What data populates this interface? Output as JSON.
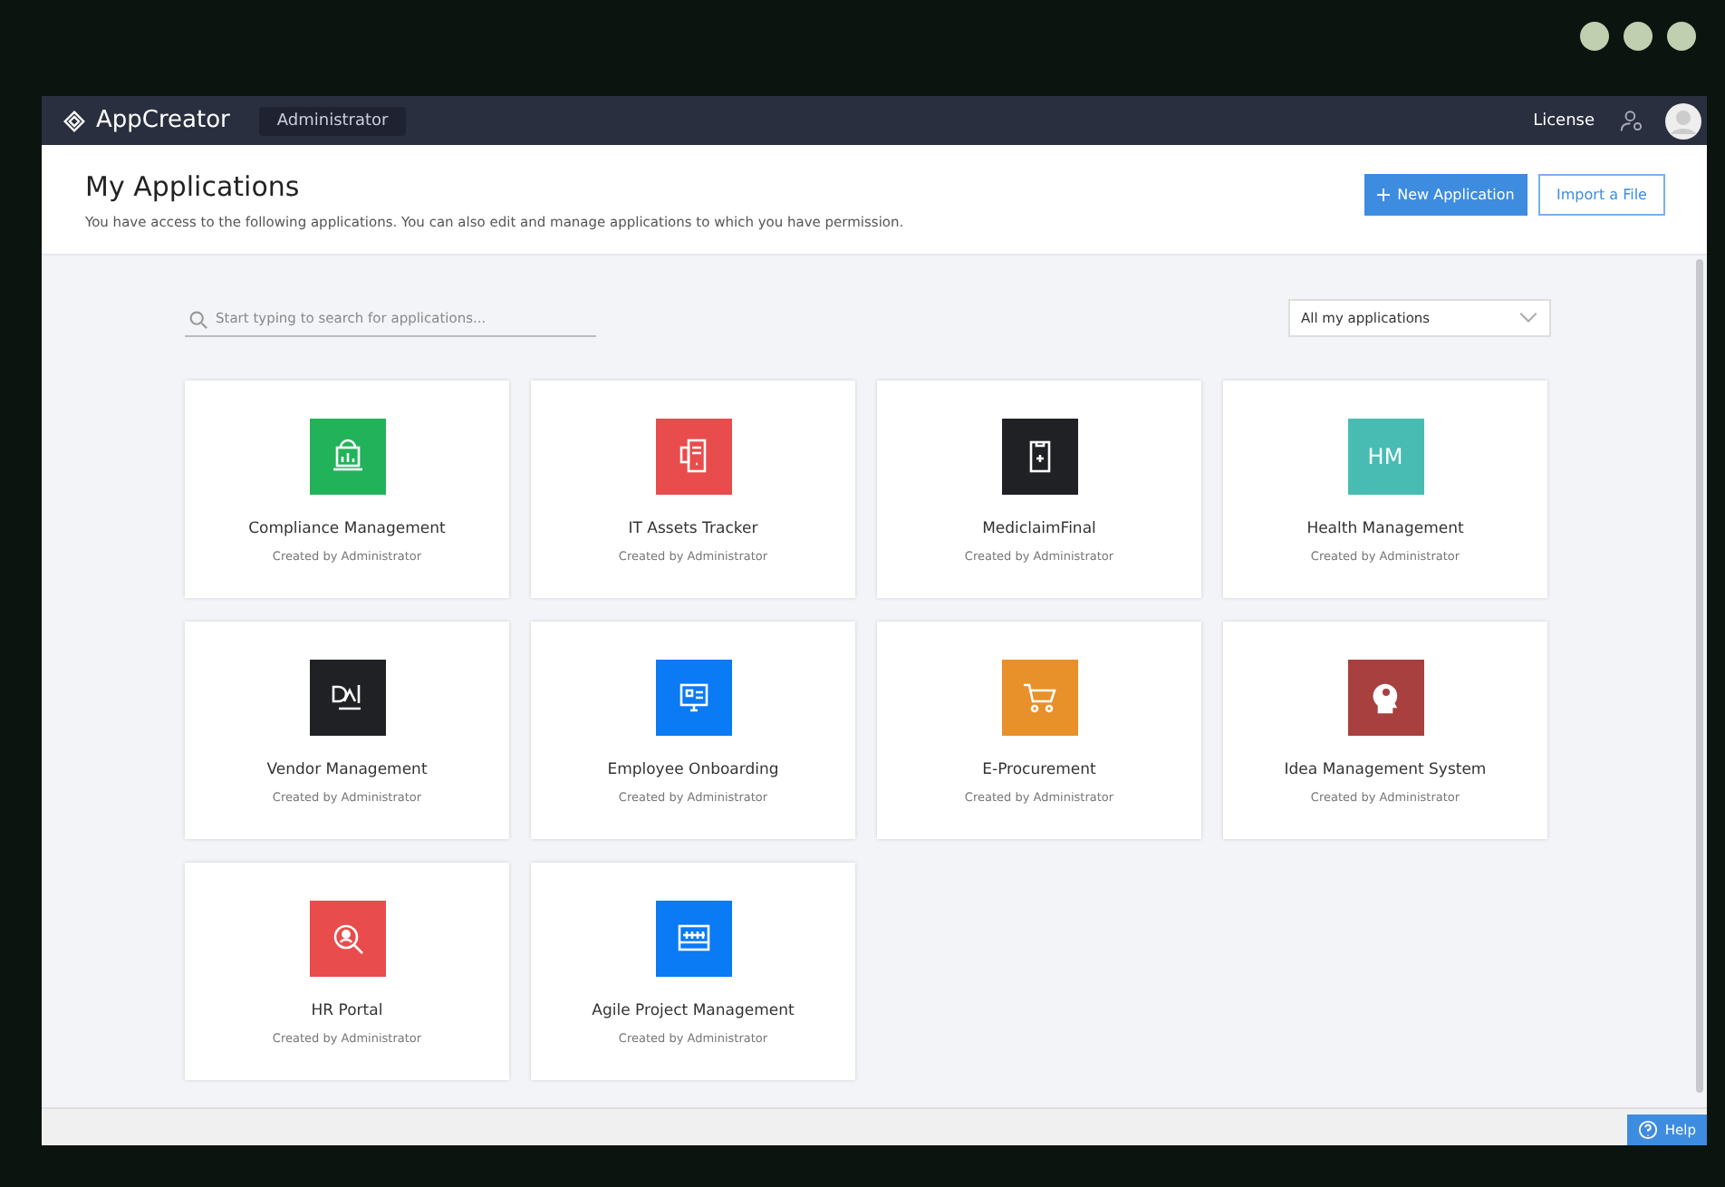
{
  "header": {
    "brand": "AppCreator",
    "role": "Administrator",
    "license_link": "License"
  },
  "page": {
    "title": "My Applications",
    "subtitle": "You have access to the following applications. You can also edit and manage applications to which you have permission.",
    "buttons": [
      {
        "kind": "primary",
        "label": "New Application"
      },
      {
        "kind": "secondary",
        "label": "Import a File"
      }
    ]
  },
  "search": {
    "placeholder": "Start typing to search for applications..."
  },
  "filter": {
    "value": "All my applications"
  },
  "apps": [
    {
      "name": "Compliance Management",
      "creator": "Created by Administrator",
      "color": "#22b35a",
      "kind": "laptop"
    },
    {
      "name": "IT Assets Tracker",
      "creator": "Created by Administrator",
      "color": "#e84c4c",
      "kind": "server"
    },
    {
      "name": "MediclaimFinal",
      "creator": "Created by Administrator",
      "color": "#1f2124",
      "kind": "clipboard"
    },
    {
      "name": "Health Management",
      "creator": "Created by Administrator",
      "color": "#48bcb2",
      "kind": "initials",
      "initials": "HM"
    },
    {
      "name": "Vendor Management",
      "creator": "Created by Administrator",
      "color": "#1f2124",
      "kind": "design"
    },
    {
      "name": "Employee Onboarding",
      "creator": "Created by Administrator",
      "color": "#0a7af5",
      "kind": "monitor"
    },
    {
      "name": "E-Procurement",
      "creator": "Created by Administrator",
      "color": "#e8902a",
      "kind": "cart"
    },
    {
      "name": "Idea Management System",
      "creator": "Created by Administrator",
      "color": "#a84040",
      "kind": "head"
    },
    {
      "name": "HR Portal",
      "creator": "Created by Administrator",
      "color": "#e84c4c",
      "kind": "person-search"
    },
    {
      "name": "Agile Project Management",
      "creator": "Created by Administrator",
      "color": "#0a7af5",
      "kind": "calendar"
    }
  ],
  "help": {
    "label": "Help"
  }
}
